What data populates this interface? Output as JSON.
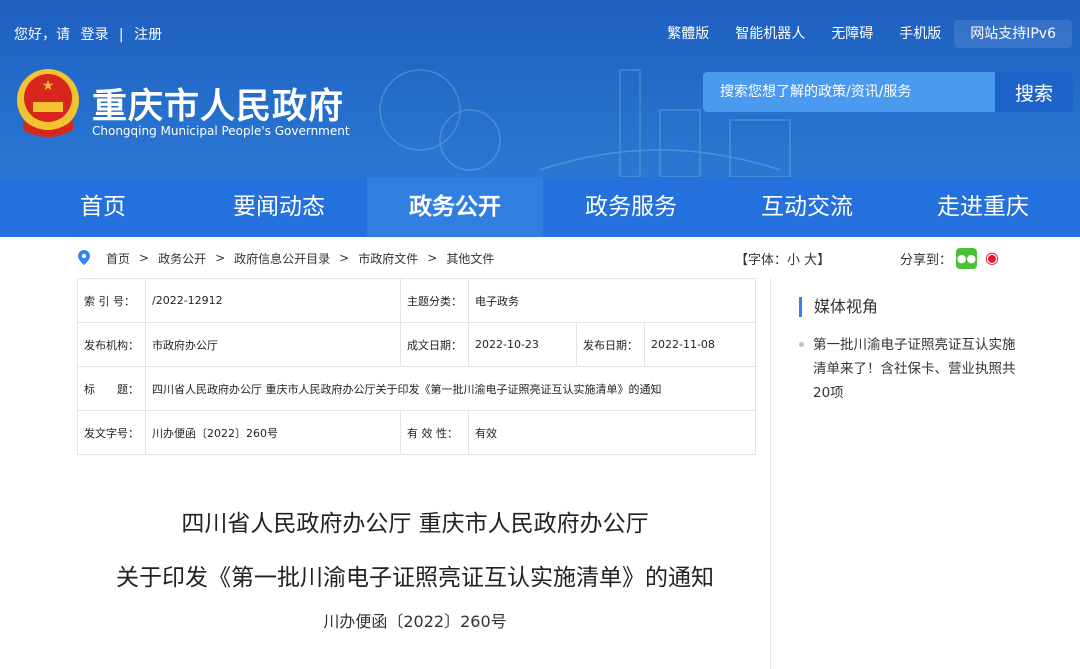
{
  "top": {
    "greeting": "您好，请",
    "login": "登录",
    "sep": "|",
    "register": "注册",
    "links": [
      "繁體版",
      "智能机器人",
      "无障碍",
      "手机版"
    ],
    "ipv6": "网站支持IPv6"
  },
  "site": {
    "title": "重庆市人民政府",
    "subtitle": "Chongqing Municipal People's Government"
  },
  "search": {
    "placeholder": "搜索您想了解的政策/资讯/服务",
    "button": "搜索"
  },
  "nav": [
    "首页",
    "要闻动态",
    "政务公开",
    "政务服务",
    "互动交流",
    "走进重庆"
  ],
  "breadcrumb": [
    "首页",
    "政务公开",
    "政府信息公开目录",
    "市政府文件",
    "其他文件"
  ],
  "font_size": {
    "label": "【字体：",
    "small": "小",
    "large": "大",
    "end": "】"
  },
  "share": {
    "label": "分享到："
  },
  "meta": {
    "index_label": "索 引 号：",
    "index": "/2022-12912",
    "topic_label": "主题分类：",
    "topic": "电子政务",
    "org_label": "发布机构：",
    "org": "市政府办公厅",
    "written_label": "成文日期：",
    "written": "2022-10-23",
    "pub_label": "发布日期：",
    "pub": "2022-11-08",
    "title_label": "标　　题：",
    "title": "四川省人民政府办公厅 重庆市人民政府办公厅关于印发《第一批川渝电子证照亮证互认实施清单》的通知",
    "docno_label": "发文字号：",
    "docno": "川办便函〔2022〕260号",
    "valid_label": "有 效 性：",
    "valid": "有效"
  },
  "doc": {
    "line1": "四川省人民政府办公厅  重庆市人民政府办公厅",
    "line2": "关于印发《第一批川渝电子证照亮证互认实施清单》的通知",
    "number": "川办便函〔2022〕260号"
  },
  "sidebar": {
    "heading": "媒体视角",
    "items": [
      "第一批川渝电子证照亮证互认实施清单来了！含社保卡、营业执照共20项"
    ]
  }
}
